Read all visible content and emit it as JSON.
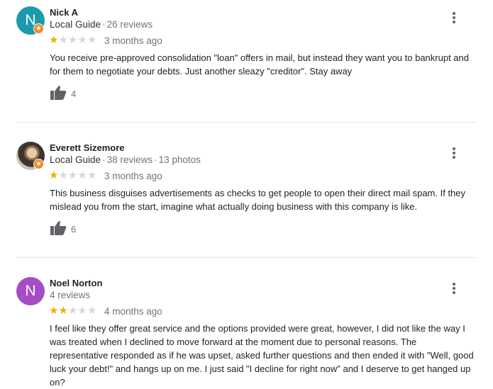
{
  "reviews": [
    {
      "avatar_letter": "N",
      "avatar_color": "#1a9bab",
      "has_guide_badge": true,
      "name": "Nick A",
      "guide_label": "Local Guide",
      "reviews_count": "26 reviews",
      "photos_count": "",
      "rating": 1,
      "date": "3 months ago",
      "text": "You receive pre-approved consolidation \"loan\" offers in mail, but instead they want you to bankrupt and for them to negotiate your debts. Just another sleazy \"creditor\". Stay away",
      "likes": "4"
    },
    {
      "avatar_letter": "",
      "avatar_color": "#6b5b4f",
      "has_guide_badge": true,
      "name": "Everett Sizemore",
      "guide_label": "Local Guide",
      "reviews_count": "38 reviews",
      "photos_count": "13 photos",
      "rating": 1,
      "date": "3 months ago",
      "text": "This business disguises advertisements as checks to get people to open their direct mail spam. If they mislead you from the start, imagine what actually doing business with this company is like.",
      "likes": "6"
    },
    {
      "avatar_letter": "N",
      "avatar_color": "#a64cc4",
      "has_guide_badge": false,
      "name": "Noel Norton",
      "guide_label": "",
      "reviews_count": "4 reviews",
      "photos_count": "",
      "rating": 2,
      "date": "4 months ago",
      "text": "I feel like they offer great service and the options provided were great, however, I did not like the way I was treated when I declined to move forward at the moment due to personal reasons. The representative responded as if he was upset, asked further questions and then ended it with \"Well, good luck your debt!\" and hangs up on me. I just said \"I decline for right now\" and I deserve to get hanged up on?",
      "likes": ""
    }
  ],
  "icons": {
    "thumbs_up": "thumbs-up-icon",
    "more": "more-vertical-icon",
    "star": "star-icon",
    "badge": "local-guide-star-icon"
  },
  "colors": {
    "star_filled": "#e7b400",
    "star_empty": "#d7d7d7",
    "badge": "#f08a24"
  }
}
